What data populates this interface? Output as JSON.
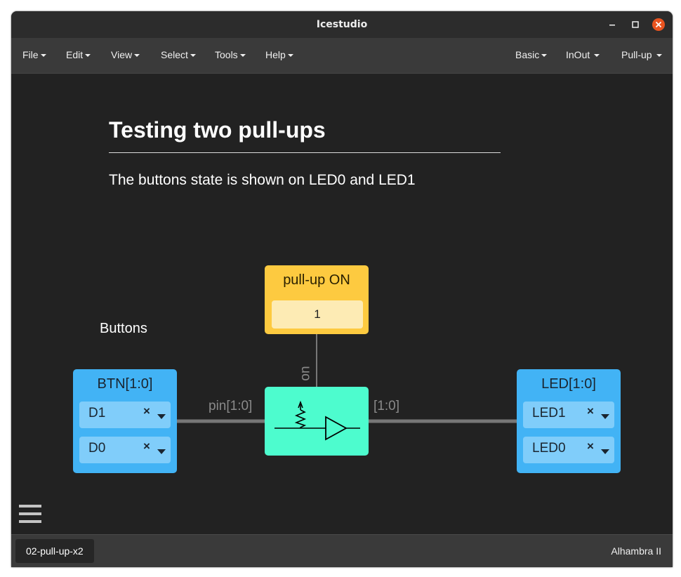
{
  "window": {
    "title": "Icestudio"
  },
  "menubar": {
    "left": [
      "File",
      "Edit",
      "View",
      "Select",
      "Tools",
      "Help"
    ],
    "right": [
      "Basic",
      "InOut",
      "Pull-up"
    ]
  },
  "document": {
    "title": "Testing two pull-ups",
    "subtitle": "The buttons state is shown on LED0 and LED1",
    "buttons_label": "Buttons"
  },
  "blocks": {
    "input": {
      "name": "BTN[1:0]",
      "pins": [
        {
          "label": "D1",
          "remove": "×"
        },
        {
          "label": "D0",
          "remove": "×"
        }
      ]
    },
    "constant": {
      "name": "pull-up ON",
      "value": "1"
    },
    "output": {
      "name": "LED[1:0]",
      "pins": [
        {
          "label": "LED1",
          "remove": "×"
        },
        {
          "label": "LED0",
          "remove": "×"
        }
      ]
    }
  },
  "wires": {
    "in_label": "pin[1:0]",
    "out_label": "[1:0]",
    "on_label": "on"
  },
  "statusbar": {
    "tab": "02-pull-up-x2",
    "board": "Alhambra II"
  },
  "colors": {
    "canvas": "#222222",
    "io_block": "#42b3f5",
    "io_pin": "#80cdfa",
    "constant_block": "#fdca40",
    "pullup_block": "#4dfcce",
    "wire": "#777777",
    "close_button": "#e95420"
  }
}
